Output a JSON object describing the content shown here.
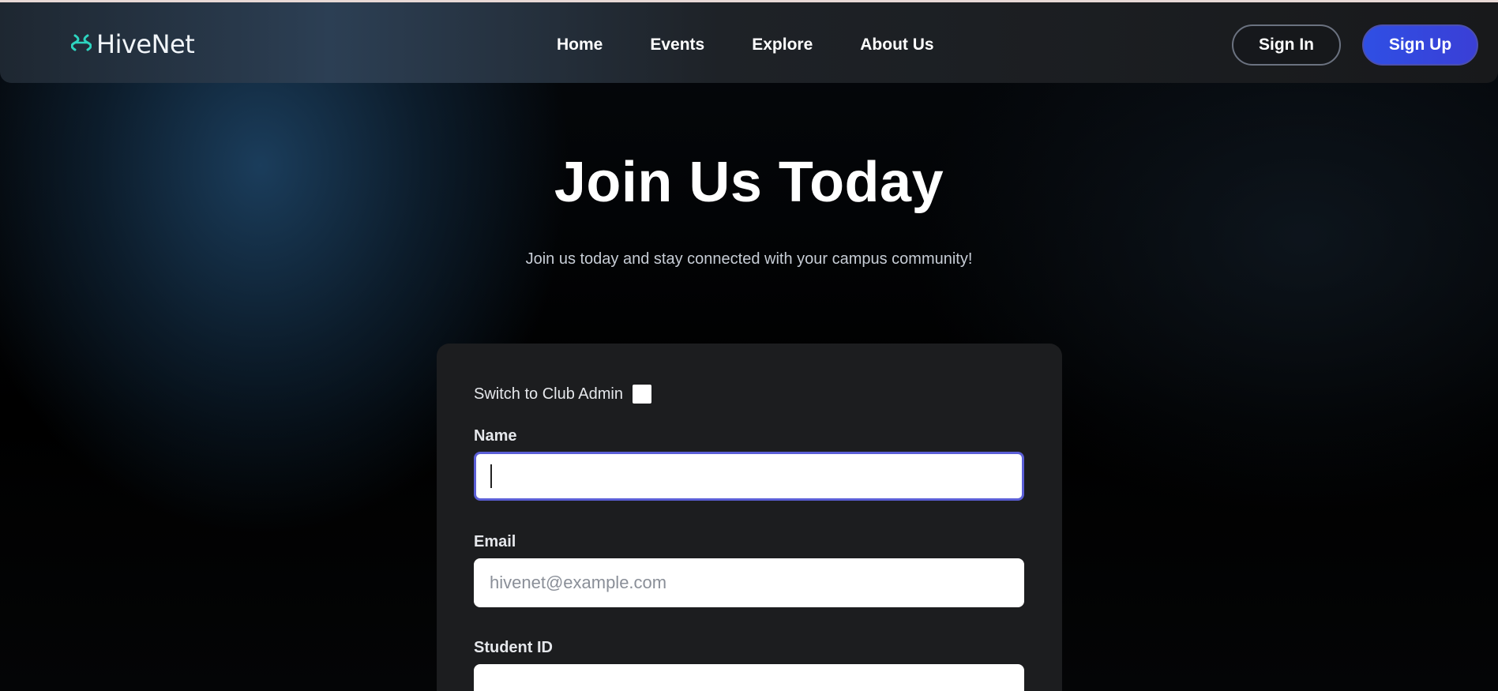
{
  "brand": {
    "name": "HiveNet",
    "icon": "hivenet-logo-icon",
    "accent": "#2dd4bf"
  },
  "nav": {
    "links": [
      "Home",
      "Events",
      "Explore",
      "About Us"
    ],
    "signin_label": "Sign In",
    "signup_label": "Sign Up"
  },
  "hero": {
    "title": "Join Us Today",
    "subtitle": "Join us today and stay connected with your campus community!"
  },
  "form": {
    "admin_toggle_label": "Switch to Club Admin",
    "admin_toggle_checked": false,
    "name_label": "Name",
    "name_value": "",
    "email_label": "Email",
    "email_placeholder": "hivenet@example.com",
    "student_id_label": "Student ID",
    "student_id_value": ""
  },
  "colors": {
    "primary_button": "#3344dd",
    "focus_ring": "#5b5fd6",
    "card_bg": "#1c1d1f"
  }
}
